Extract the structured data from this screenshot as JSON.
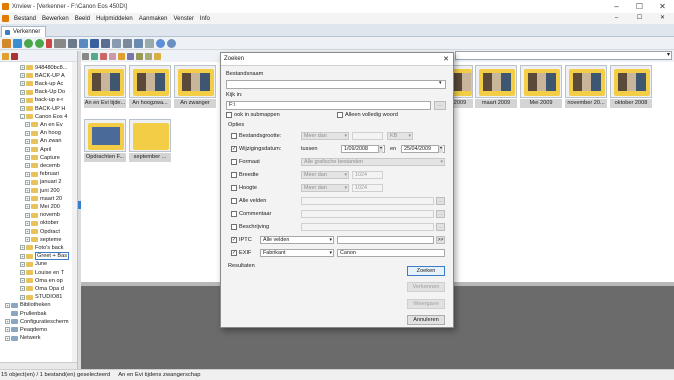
{
  "window": {
    "title": "Xnview - [Verkenner - F:\\Canon Eos 450D\\]",
    "controls": [
      "–",
      "☐",
      "✕"
    ]
  },
  "menu": [
    "Bestand",
    "Bewerken",
    "Beeld",
    "Hulpmiddelen",
    "Aanmaken",
    "Venster",
    "Info"
  ],
  "mdi_controls": [
    "–",
    "☐",
    "✕"
  ],
  "tab": {
    "label": "Verkenner"
  },
  "tree": {
    "items": [
      {
        "label": "948480bc8...",
        "indent": 4,
        "exp": "+"
      },
      {
        "label": "BACK-UP A",
        "indent": 4,
        "exp": "+"
      },
      {
        "label": "Back-up Ac",
        "indent": 4,
        "exp": "+"
      },
      {
        "label": "Back-Up Do",
        "indent": 4,
        "exp": "+"
      },
      {
        "label": "back-up e-r",
        "indent": 4,
        "exp": "+"
      },
      {
        "label": "BACK-UP H",
        "indent": 4,
        "exp": "+"
      },
      {
        "label": "Canon Eos 4",
        "indent": 4,
        "exp": "-"
      },
      {
        "label": "An en Ev",
        "indent": 5,
        "exp": "+"
      },
      {
        "label": "An hoog",
        "indent": 5,
        "exp": "+"
      },
      {
        "label": "An zwan",
        "indent": 5,
        "exp": "+"
      },
      {
        "label": "April",
        "indent": 5,
        "exp": "+"
      },
      {
        "label": "Capture",
        "indent": 5,
        "exp": "+"
      },
      {
        "label": "decemb",
        "indent": 5,
        "exp": "+"
      },
      {
        "label": "februari",
        "indent": 5,
        "exp": "+"
      },
      {
        "label": "januari 2",
        "indent": 5,
        "exp": "+"
      },
      {
        "label": "juni 200",
        "indent": 5,
        "exp": "+"
      },
      {
        "label": "maart 20",
        "indent": 5,
        "exp": "+"
      },
      {
        "label": "Mei 200",
        "indent": 5,
        "exp": "+"
      },
      {
        "label": "novemb",
        "indent": 5,
        "exp": "+"
      },
      {
        "label": "oktober",
        "indent": 5,
        "exp": "+"
      },
      {
        "label": "Opdract",
        "indent": 5,
        "exp": "+"
      },
      {
        "label": "septeme",
        "indent": 5,
        "exp": "+"
      },
      {
        "label": "Foto's back",
        "indent": 4,
        "exp": "+"
      },
      {
        "label": "Greet + Bas",
        "indent": 4,
        "exp": "+"
      },
      {
        "label": "June",
        "indent": 4,
        "exp": "+"
      },
      {
        "label": "Louise en T",
        "indent": 4,
        "exp": "+"
      },
      {
        "label": "Oma en op",
        "indent": 4,
        "exp": "+"
      },
      {
        "label": "Oma Opa d",
        "indent": 4,
        "exp": "+"
      },
      {
        "label": "STUDIO81",
        "indent": 4,
        "exp": "+"
      },
      {
        "label": "Bibliotheken",
        "indent": 1,
        "exp": "+"
      },
      {
        "label": "Prullenbak",
        "indent": 1,
        "exp": ""
      },
      {
        "label": "Configuratiescherm",
        "indent": 1,
        "exp": "+"
      },
      {
        "label": "Peaqdemo",
        "indent": 1,
        "exp": "+"
      },
      {
        "label": "Netwerk",
        "indent": 1,
        "exp": "+"
      }
    ]
  },
  "thumbs": [
    {
      "caption": "An en Evi tijde..."
    },
    {
      "caption": "An hoogzwa..."
    },
    {
      "caption": "An zwanger"
    },
    {
      "caption": "Opdrachten F..."
    },
    {
      "caption": "september ..."
    },
    {
      "caption": "2009"
    },
    {
      "caption": "maart 2009"
    },
    {
      "caption": "Mei 2009"
    },
    {
      "caption": "november 20..."
    },
    {
      "caption": "oktober 2008"
    }
  ],
  "dialog": {
    "title": "Zoeken",
    "close": "✕",
    "bestandsnaam_label": "Bestandsnaam",
    "bestandsnaam_value": "",
    "kijkin_label": "Kijk in:",
    "kijkin_value": "F:\\",
    "browse": "...",
    "ook_submappen": "ook in submappen",
    "alleen_woord": "Alleen volledig woord",
    "opties": "Opties",
    "bestandsgrootte": "Bestandsgrootte:",
    "meer_dan": "Meer dan",
    "kb": "KB",
    "wijzigingsdatum": "Wijzigingsdatum:",
    "tussen": "tussen",
    "date_from": "1/09/2008",
    "en": "en",
    "date_to": "25/04/2009",
    "formaat": "Formaat",
    "formaat_value": "Alle grafische bestanden",
    "breedte": "Breedte",
    "hoogte": "Hoogte",
    "num_1024": "1024",
    "alle_velden": "Alle velden",
    "commentaar": "Commentaar",
    "beschrijving": "Beschrijving",
    "iptc": "IPTC",
    "iptc_field": "Alle velden",
    "iptc_btn": ">>",
    "exif": "EXIF",
    "exif_field": "Fabrikant",
    "exif_value": "Canon",
    "resultaten": "Resultaten",
    "btn_zoeken": "Zoeken",
    "btn_verkennen": "Verkennen",
    "btn_weergave": "Weergave",
    "btn_annuleren": "Annuleren"
  },
  "status": {
    "count": "15 object(en) / 1 bestand(en) geselecteerd",
    "selected": "An en Evi tijdens zwangerschap"
  },
  "colors": {
    "accent": "#3a7cc7",
    "folder": "#f3cd45",
    "dark_panel": "#6b6b6b"
  }
}
